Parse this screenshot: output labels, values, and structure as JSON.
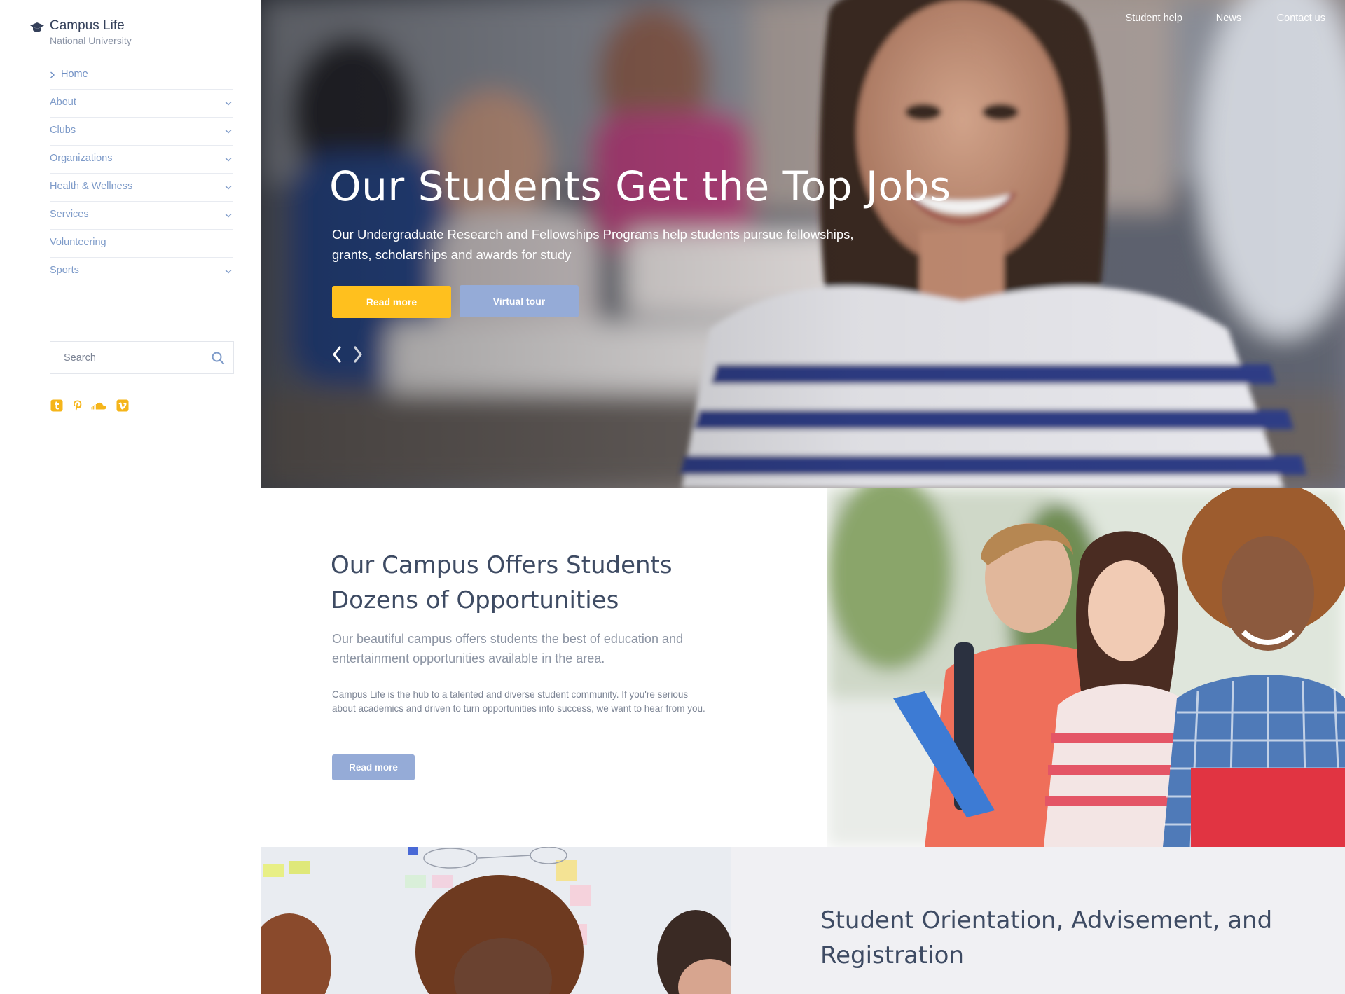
{
  "brand": {
    "title": "Campus Life",
    "subtitle": "National University",
    "icon": "graduation-cap-icon"
  },
  "sidebar": {
    "nav": [
      {
        "label": "Home",
        "active": true,
        "expandable": false
      },
      {
        "label": "About",
        "expandable": true
      },
      {
        "label": "Clubs",
        "expandable": true
      },
      {
        "label": "Organizations",
        "expandable": true
      },
      {
        "label": "Health & Wellness",
        "expandable": true
      },
      {
        "label": "Services",
        "expandable": true
      },
      {
        "label": "Volunteering",
        "expandable": false
      },
      {
        "label": "Sports",
        "expandable": true
      }
    ],
    "search": {
      "placeholder": "Search"
    },
    "socials": [
      "tumblr-icon",
      "pinterest-icon",
      "soundcloud-icon",
      "vimeo-icon"
    ]
  },
  "top_nav": {
    "links": [
      "Student help",
      "News",
      "Contact us"
    ]
  },
  "hero": {
    "title": "Our Students Get the Top Jobs",
    "text": "Our Undergraduate Research and Fellowships Programs help students pursue fellowships, grants, scholarships and awards for study",
    "read_more": "Read more",
    "virtual_tour": "Virtual tour"
  },
  "section2": {
    "title": "Our Campus Offers Students Dozens of Opportunities",
    "lead": "Our beautiful campus offers students the best of education and entertainment opportunities available in the area.",
    "body": "Campus Life is the hub to a talented and diverse student community. If you're serious about academics and driven to turn opportunities into success, we want to hear from you.",
    "button": "Read more"
  },
  "section3": {
    "title": "Student Orientation, Advisement, and Registration"
  },
  "colors": {
    "accent_yellow": "#ffc01e",
    "accent_blue": "#95abd7",
    "heading": "#3e4b63",
    "nav_link": "#7e9bc9"
  }
}
